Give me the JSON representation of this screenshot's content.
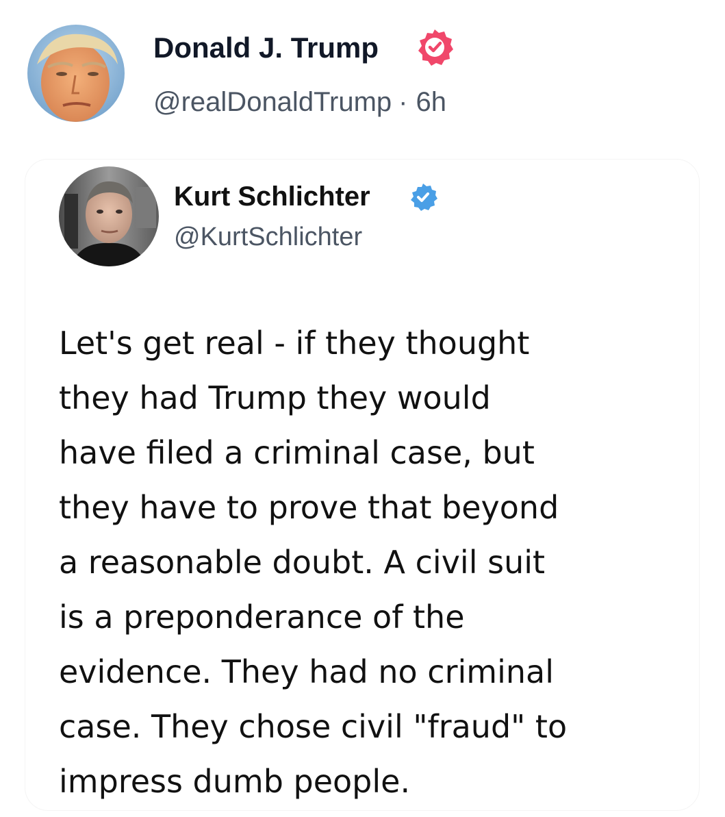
{
  "post": {
    "author_name": "Donald J. Trump",
    "author_handle": "@realDonaldTrump",
    "separator": "·",
    "time_ago": "6h",
    "verified_badge_color": "#f0476a"
  },
  "quoted_post": {
    "author_name": "Kurt Schlichter",
    "author_handle": "@KurtSchlichter",
    "verified_badge_color": "#4a9fe6",
    "text_lines": [
      "Let's get real - if they thought",
      "they had Trump they would",
      "have filed a criminal case, but",
      "they have to prove that beyond",
      "a reasonable doubt. A civil suit",
      "is a preponderance of the",
      "evidence. They had no criminal",
      "case. They chose civil \"fraud\" to",
      "impress dumb people."
    ]
  },
  "icons": {
    "main_avatar": "avatar-photo",
    "main_verified": "verified-badge-icon",
    "quoted_avatar": "avatar-photo",
    "quoted_verified": "verified-badge-icon"
  }
}
